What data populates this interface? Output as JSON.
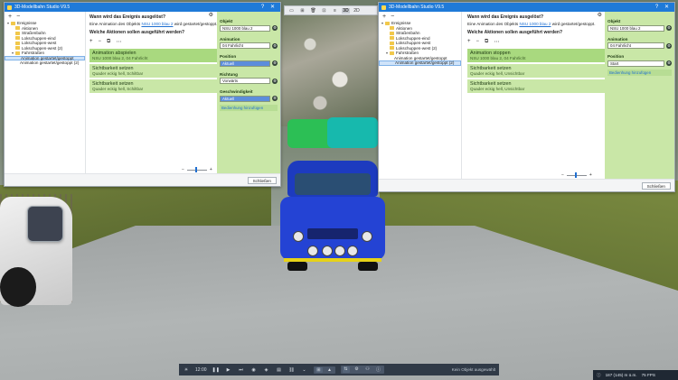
{
  "colors": {
    "accent": "#1f7ad8",
    "action_green": "#c9e7a7",
    "panel_green": "#c9e7a7",
    "bar_dark": "#303a47"
  },
  "top_toolbar": {
    "items": [
      {
        "icon": "folder-icon",
        "label": "▭"
      },
      {
        "icon": "grid-icon",
        "label": "⊞"
      },
      {
        "icon": "trash-icon",
        "label": "🗑"
      },
      {
        "icon": "map-icon",
        "label": "⊡"
      },
      {
        "icon": "layers-icon",
        "label": "≡"
      },
      {
        "icon": "view-3d",
        "label": "3D"
      },
      {
        "icon": "view-2d",
        "label": "2D"
      }
    ]
  },
  "left_window": {
    "title": "3D-Modellbahn Studio V9.5",
    "toolbar": [
      "+",
      "−"
    ],
    "tree": [
      {
        "label": "Ereignisse",
        "level": 0,
        "caret": "▾",
        "folder": true
      },
      {
        "label": "Aktionen",
        "level": 1,
        "caret": "",
        "folder": true
      },
      {
        "label": "Straßenbahn",
        "level": 1,
        "caret": "",
        "folder": true
      },
      {
        "label": "Lokschuppen-eind",
        "level": 1,
        "caret": "",
        "folder": true
      },
      {
        "label": "Lokschuppen-west",
        "level": 1,
        "caret": "",
        "folder": true
      },
      {
        "label": "Lokschuppen-west (2)",
        "level": 1,
        "caret": "",
        "folder": true
      },
      {
        "label": "Fahrstraßen",
        "level": 1,
        "caret": "▾",
        "folder": true
      },
      {
        "label": "Animation gestartet/gestoppt",
        "level": 2,
        "caret": "",
        "folder": false,
        "selected": true
      },
      {
        "label": "Animation gestartet/gestoppt (2)",
        "level": 2,
        "caret": "",
        "folder": false
      }
    ],
    "question1": "Wann wird das Ereignis ausgelöst?",
    "question1_prefix": "Eine Animation des Objekts ",
    "question1_link": "NSU 1000 blau 2",
    "question1_suffix": " wird gestartet/gestoppt.",
    "question2": "Welche Aktionen sollen ausgeführt werden?",
    "actions_toolbar": [
      "+",
      "−",
      "⧉",
      "⋯"
    ],
    "actions": [
      {
        "title": "Animation abspielen",
        "sub": "NSU 1000 blau 2, 04 Fahrlicht",
        "selected": true
      },
      {
        "title": "Sichtbarkeit setzen",
        "sub": "Quader eckig hell, Schiltbar",
        "selected": false
      },
      {
        "title": "Sichtbarkeit setzen",
        "sub": "Quader eckig hell, Schiltbar",
        "selected": false
      }
    ],
    "props": {
      "objekt_label": "Objekt",
      "objekt_value": "NSU 1000 blau 2",
      "animation_label": "Animation",
      "animation_value": "04 Fahrlicht",
      "position_label": "Position",
      "position_value": "Aktuell",
      "richtung_label": "Richtung",
      "richtung_value": "Vorwärts",
      "geschw_label": "Geschwindigkeit",
      "geschw_value": "Aktuell",
      "link": "Bedienhung hinzufügen"
    },
    "close_label": "Schließen"
  },
  "right_window": {
    "title": "3D-Modellbahn Studio V9.5",
    "toolbar": [
      "+",
      "−"
    ],
    "tree": [
      {
        "label": "Ereignisse",
        "level": 0,
        "caret": "▾",
        "folder": true
      },
      {
        "label": "Aktionen",
        "level": 1,
        "caret": "",
        "folder": true
      },
      {
        "label": "Straßenbahn",
        "level": 1,
        "caret": "",
        "folder": true
      },
      {
        "label": "Lokschuppen-eind",
        "level": 1,
        "caret": "",
        "folder": true
      },
      {
        "label": "Lokschuppen-west",
        "level": 1,
        "caret": "",
        "folder": true
      },
      {
        "label": "Lokschuppen-west (2)",
        "level": 1,
        "caret": "",
        "folder": true
      },
      {
        "label": "Fahrstraßen",
        "level": 1,
        "caret": "▾",
        "folder": true
      },
      {
        "label": "Animation gestartet/gestoppt",
        "level": 2,
        "caret": "",
        "folder": false
      },
      {
        "label": "Animation gestartet/gestoppt (2)",
        "level": 2,
        "caret": "",
        "folder": false,
        "selected": true
      }
    ],
    "question1": "Wann wird das Ereignis ausgelöst?",
    "question1_prefix": "Eine Animation des Objekts ",
    "question1_link": "NSU 1000 blau 2",
    "question1_suffix": " wird gestartet/gestoppt.",
    "question2": "Welche Aktionen sollen ausgeführt werden?",
    "actions_toolbar": [
      "+",
      "−",
      "⧉",
      "⋯"
    ],
    "actions": [
      {
        "title": "Animation stoppen",
        "sub": "NSU 1000 blau 2, 04 Fahrlicht",
        "selected": true
      },
      {
        "title": "Sichtbarkeit setzen",
        "sub": "Quader eckig hell, Unsichtbar",
        "selected": false
      },
      {
        "title": "Sichtbarkeit setzen",
        "sub": "Quader eckig hell, Unsichtbar",
        "selected": false
      }
    ],
    "props": {
      "objekt_label": "Objekt",
      "objekt_value": "NSU 1000 blau 2",
      "animation_label": "Animation",
      "animation_value": "04 Fahrlicht",
      "position_label": "Position",
      "position_value": "Start",
      "link": "Bedienhung hinzufügen"
    },
    "close_label": "Schließen"
  },
  "bottombar": {
    "time": "12:00",
    "status": "Kein Objekt ausgewählt"
  },
  "statusbar": {
    "info": "187 (145) m ü.m.",
    "fps": "75 FPS"
  }
}
